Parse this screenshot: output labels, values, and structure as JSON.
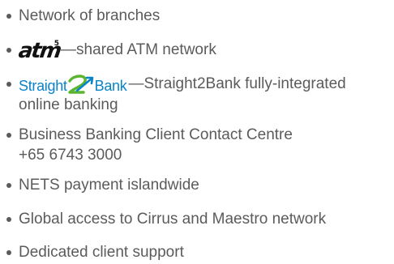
{
  "items": [
    {
      "text": "Network of branches"
    },
    {
      "logo_text": "atm",
      "logo_superscript": "5",
      "text": "—shared ATM network"
    },
    {
      "logo_left": "Straight",
      "logo_right": "Bank",
      "text_line1": "—Straight2Bank fully-integrated",
      "text_line2": "online banking"
    },
    {
      "text_line1": "Business Banking Client Contact Centre",
      "text_line2": "+65 6743 3000"
    },
    {
      "text": "NETS payment islandwide"
    },
    {
      "text": "Global access to Cirrus and Maestro network"
    },
    {
      "text": "Dedicated client support"
    }
  ],
  "colors": {
    "text": "#5b5b5b",
    "straight2bank_blue": "#0a83c8",
    "straight2bank_green": "#5cb531",
    "atm_logo": "#111111"
  }
}
